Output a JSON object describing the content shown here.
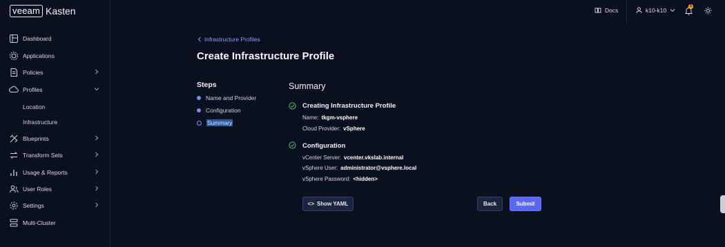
{
  "brand": {
    "logo": "veeam",
    "name": "Kasten"
  },
  "topbar": {
    "docs_label": "Docs",
    "user_label": "k10-k10",
    "notification_count": "1"
  },
  "sidebar": {
    "items": [
      {
        "label": "Dashboard",
        "icon": "dashboard-icon"
      },
      {
        "label": "Applications",
        "icon": "applications-icon"
      },
      {
        "label": "Policies",
        "icon": "policies-icon"
      },
      {
        "label": "Profiles",
        "icon": "profiles-icon"
      },
      {
        "label": "Blueprints",
        "icon": "blueprints-icon"
      },
      {
        "label": "Transform Sets",
        "icon": "transform-icon"
      },
      {
        "label": "Usage & Reports",
        "icon": "reports-icon"
      },
      {
        "label": "User Roles",
        "icon": "user-roles-icon"
      },
      {
        "label": "Settings",
        "icon": "gear-icon"
      },
      {
        "label": "Multi-Cluster",
        "icon": "multi-cluster-icon"
      }
    ],
    "sub_items": [
      "Location",
      "Infrastructure"
    ]
  },
  "main": {
    "breadcrumb": "Infrastructure Profiles",
    "title": "Create Infrastructure Profile",
    "steps_title": "Steps",
    "steps": [
      "Name and Provider",
      "Configuration",
      "Summary"
    ],
    "summary": {
      "title": "Summary",
      "section1": {
        "title": "Creating Infrastructure Profile",
        "name_label": "Name:",
        "name_value": "tkgm-vsphere",
        "provider_label": "Cloud Provider:",
        "provider_value": "vSphere"
      },
      "section2": {
        "title": "Configuration",
        "server_label": "vCenter Server:",
        "server_value": "vcenter.vkslab.internal",
        "user_label": "vSphere User:",
        "user_value": "administrator@vsphere.local",
        "password_label": "vSphere Password:",
        "password_value": "<hidden>"
      }
    },
    "buttons": {
      "yaml": "Show YAML",
      "back": "Back",
      "submit": "Submit"
    }
  },
  "colors": {
    "background": "#0b1020",
    "accent": "#5a67f0",
    "success": "#4cc46a",
    "link": "#8c9cff"
  }
}
